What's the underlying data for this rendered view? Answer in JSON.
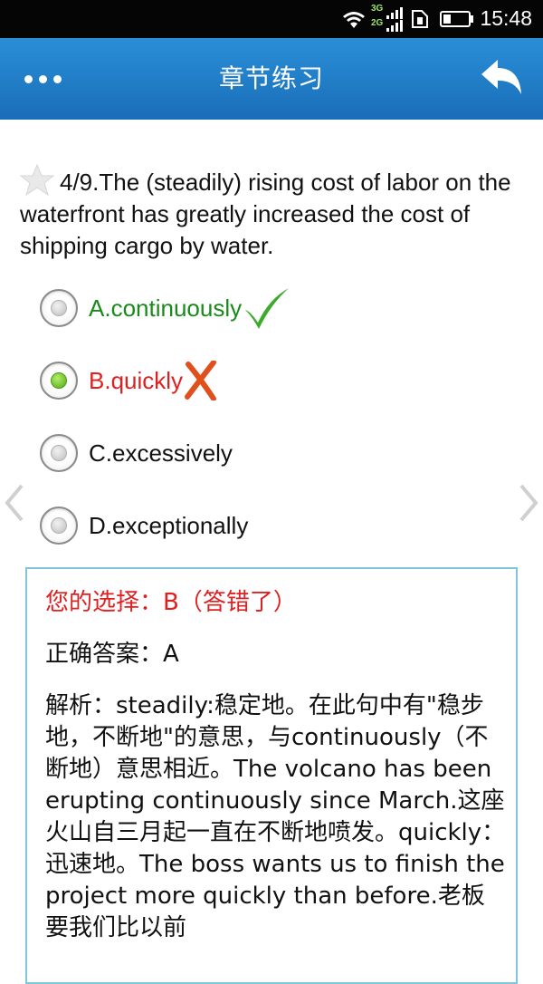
{
  "status_bar": {
    "time": "15:48",
    "network_top": "3G",
    "network_bottom": "2G"
  },
  "header": {
    "title": "章节练习"
  },
  "question": {
    "number": "4/9.",
    "text": "The (steadily) rising cost of labor on the waterfront has greatly increased the cost of shipping cargo by water."
  },
  "options": [
    {
      "label": "A.continuously",
      "state": "correct"
    },
    {
      "label": "B.quickly",
      "state": "wrong",
      "selected": true
    },
    {
      "label": "C.excessively",
      "state": "normal"
    },
    {
      "label": "D.exceptionally",
      "state": "normal"
    }
  ],
  "answer": {
    "your_choice": "您的选择：B（答错了）",
    "correct": "正确答案：A",
    "analysis": "解析：steadily:稳定地。在此句中有\"稳步地，不断地\"的意思，与continuously（不断地）意思相近。The volcano has been erupting continuously since March.这座火山自三月起一直在不断地喷发。quickly：迅速地。The boss wants us to finish the project more quickly than before.老板要我们比以前"
  },
  "colors": {
    "header_top": "#2a8fd8",
    "header_bottom": "#1a6db8",
    "correct": "#1a8a1a",
    "wrong": "#e02020",
    "panel_border": "#7fc6de"
  }
}
